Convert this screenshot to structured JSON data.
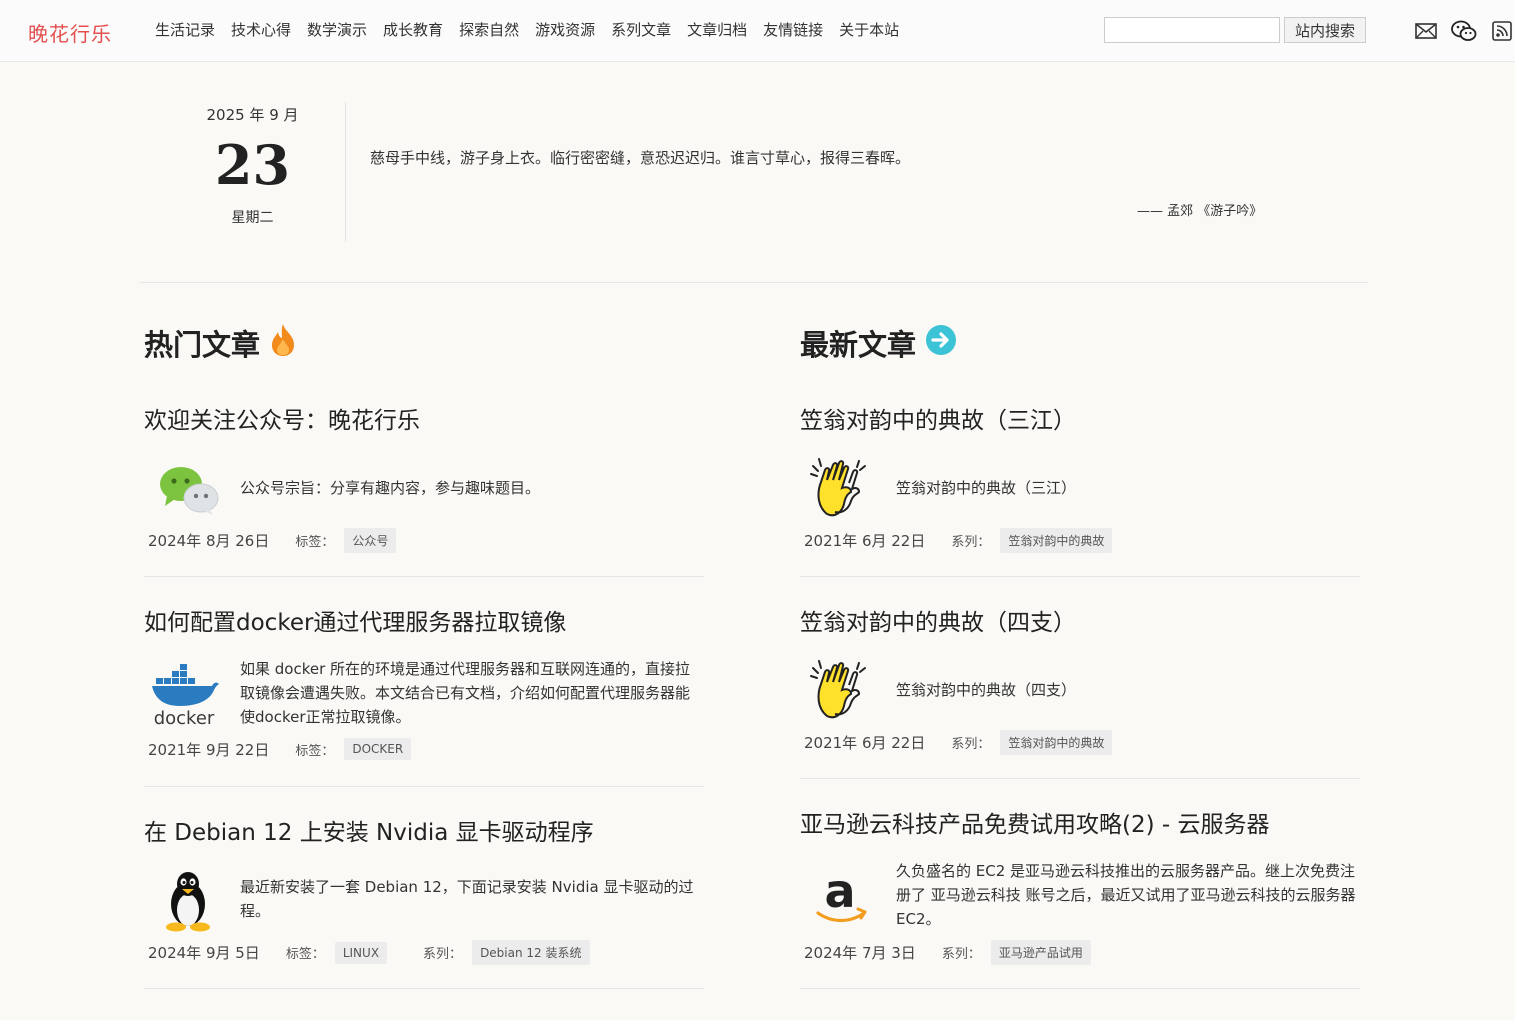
{
  "header": {
    "logo": "晚花行乐",
    "nav": [
      "生活记录",
      "技术心得",
      "数学演示",
      "成长教育",
      "探索自然",
      "游戏资源",
      "系列文章",
      "文章归档",
      "友情链接",
      "关于本站"
    ],
    "search_placeholder": "",
    "search_button": "站内搜索",
    "icons": [
      "mail-icon",
      "wechat-icon",
      "rss-icon"
    ]
  },
  "date": {
    "year_month": "2025 年 9 月",
    "day": "23",
    "weekday": "星期二"
  },
  "quote": {
    "text": "慈母手中线，游子身上衣。临行密密缝，意恐迟迟归。谁言寸草心，报得三春晖。",
    "source": "—— 孟郊 《游子吟》"
  },
  "hot": {
    "title": "热门文章",
    "articles": [
      {
        "title": "欢迎关注公众号：晚花行乐",
        "excerpt": "公众号宗旨：分享有趣内容，参与趣味题目。",
        "date": "2024年 8月 26日",
        "label1": "标签：",
        "tag1": "公众号",
        "thumb": "wechat-thumb-icon"
      },
      {
        "title": "如何配置docker通过代理服务器拉取镜像",
        "excerpt": "如果 docker 所在的环境是通过代理服务器和互联网连通的，直接拉取镜像会遭遇失败。本文结合已有文档，介绍如何配置代理服务器能使docker正常拉取镜像。",
        "date": "2021年 9月 22日",
        "label1": "标签：",
        "tag1": "DOCKER",
        "thumb": "docker-logo-icon",
        "thumb_text": "docker"
      },
      {
        "title": "在 Debian 12 上安装 Nvidia 显卡驱动程序",
        "excerpt": "最近新安装了一套 Debian 12，下面记录安装 Nvidia 显卡驱动的过程。",
        "date": "2024年 9月 5日",
        "label1": "标签：",
        "tag1": "LINUX",
        "label2": "系列：",
        "tag2": "Debian 12 装系统",
        "thumb": "linux-penguin-icon"
      }
    ]
  },
  "latest": {
    "title": "最新文章",
    "articles": [
      {
        "title": "笠翁对韵中的典故（三江）",
        "excerpt": "笠翁对韵中的典故（三江）",
        "date": "2021年 6月 22日",
        "label1": "系列：",
        "tag1": "笠翁对韵中的典故",
        "thumb": "clapping-hands-icon"
      },
      {
        "title": "笠翁对韵中的典故（四支）",
        "excerpt": "笠翁对韵中的典故（四支）",
        "date": "2021年 6月 22日",
        "label1": "系列：",
        "tag1": "笠翁对韵中的典故",
        "thumb": "clapping-hands-icon"
      },
      {
        "title": "亚马逊云科技产品免费试用攻略(2) - 云服务器",
        "excerpt": "久负盛名的 EC2 是亚马逊云科技推出的云服务器产品。继上次免费注册了 亚马逊云科技 账号之后，最近又试用了亚马逊云科技的云服务器 EC2。",
        "date": "2024年 7月 3日",
        "label1": "系列：",
        "tag1": "亚马逊产品试用",
        "thumb": "amazon-logo-icon",
        "thumb_text": "a"
      }
    ]
  },
  "colors": {
    "logo": "#e34f4f",
    "fire": "#f28b1c",
    "arrow_circle": "#3cc3d6",
    "docker_blue": "#2a7bbf",
    "clap_yellow": "#ffe02b",
    "amazon_orange": "#f29d1e"
  }
}
